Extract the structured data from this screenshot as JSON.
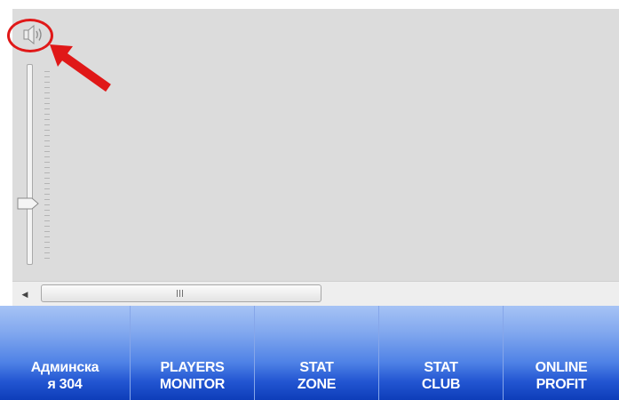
{
  "icons": {
    "speaker": "speaker-icon",
    "scroll_left": "chevron-left-icon",
    "scroll_grip": "grip-icon"
  },
  "volume": {
    "level": 0.32
  },
  "colors": {
    "panel": "#dcdcdc",
    "annotation": "#e01818",
    "tab_top": "#a6c3f5",
    "tab_bottom": "#0e3db9"
  },
  "tabs": [
    {
      "line1": "Админска",
      "line2": "я 304"
    },
    {
      "line1": "PLAYERS",
      "line2": "MONITOR"
    },
    {
      "line1": "STAT",
      "line2": "ZONE"
    },
    {
      "line1": "STAT",
      "line2": "CLUB"
    },
    {
      "line1": "ONLINE",
      "line2": "PROFIT"
    }
  ]
}
